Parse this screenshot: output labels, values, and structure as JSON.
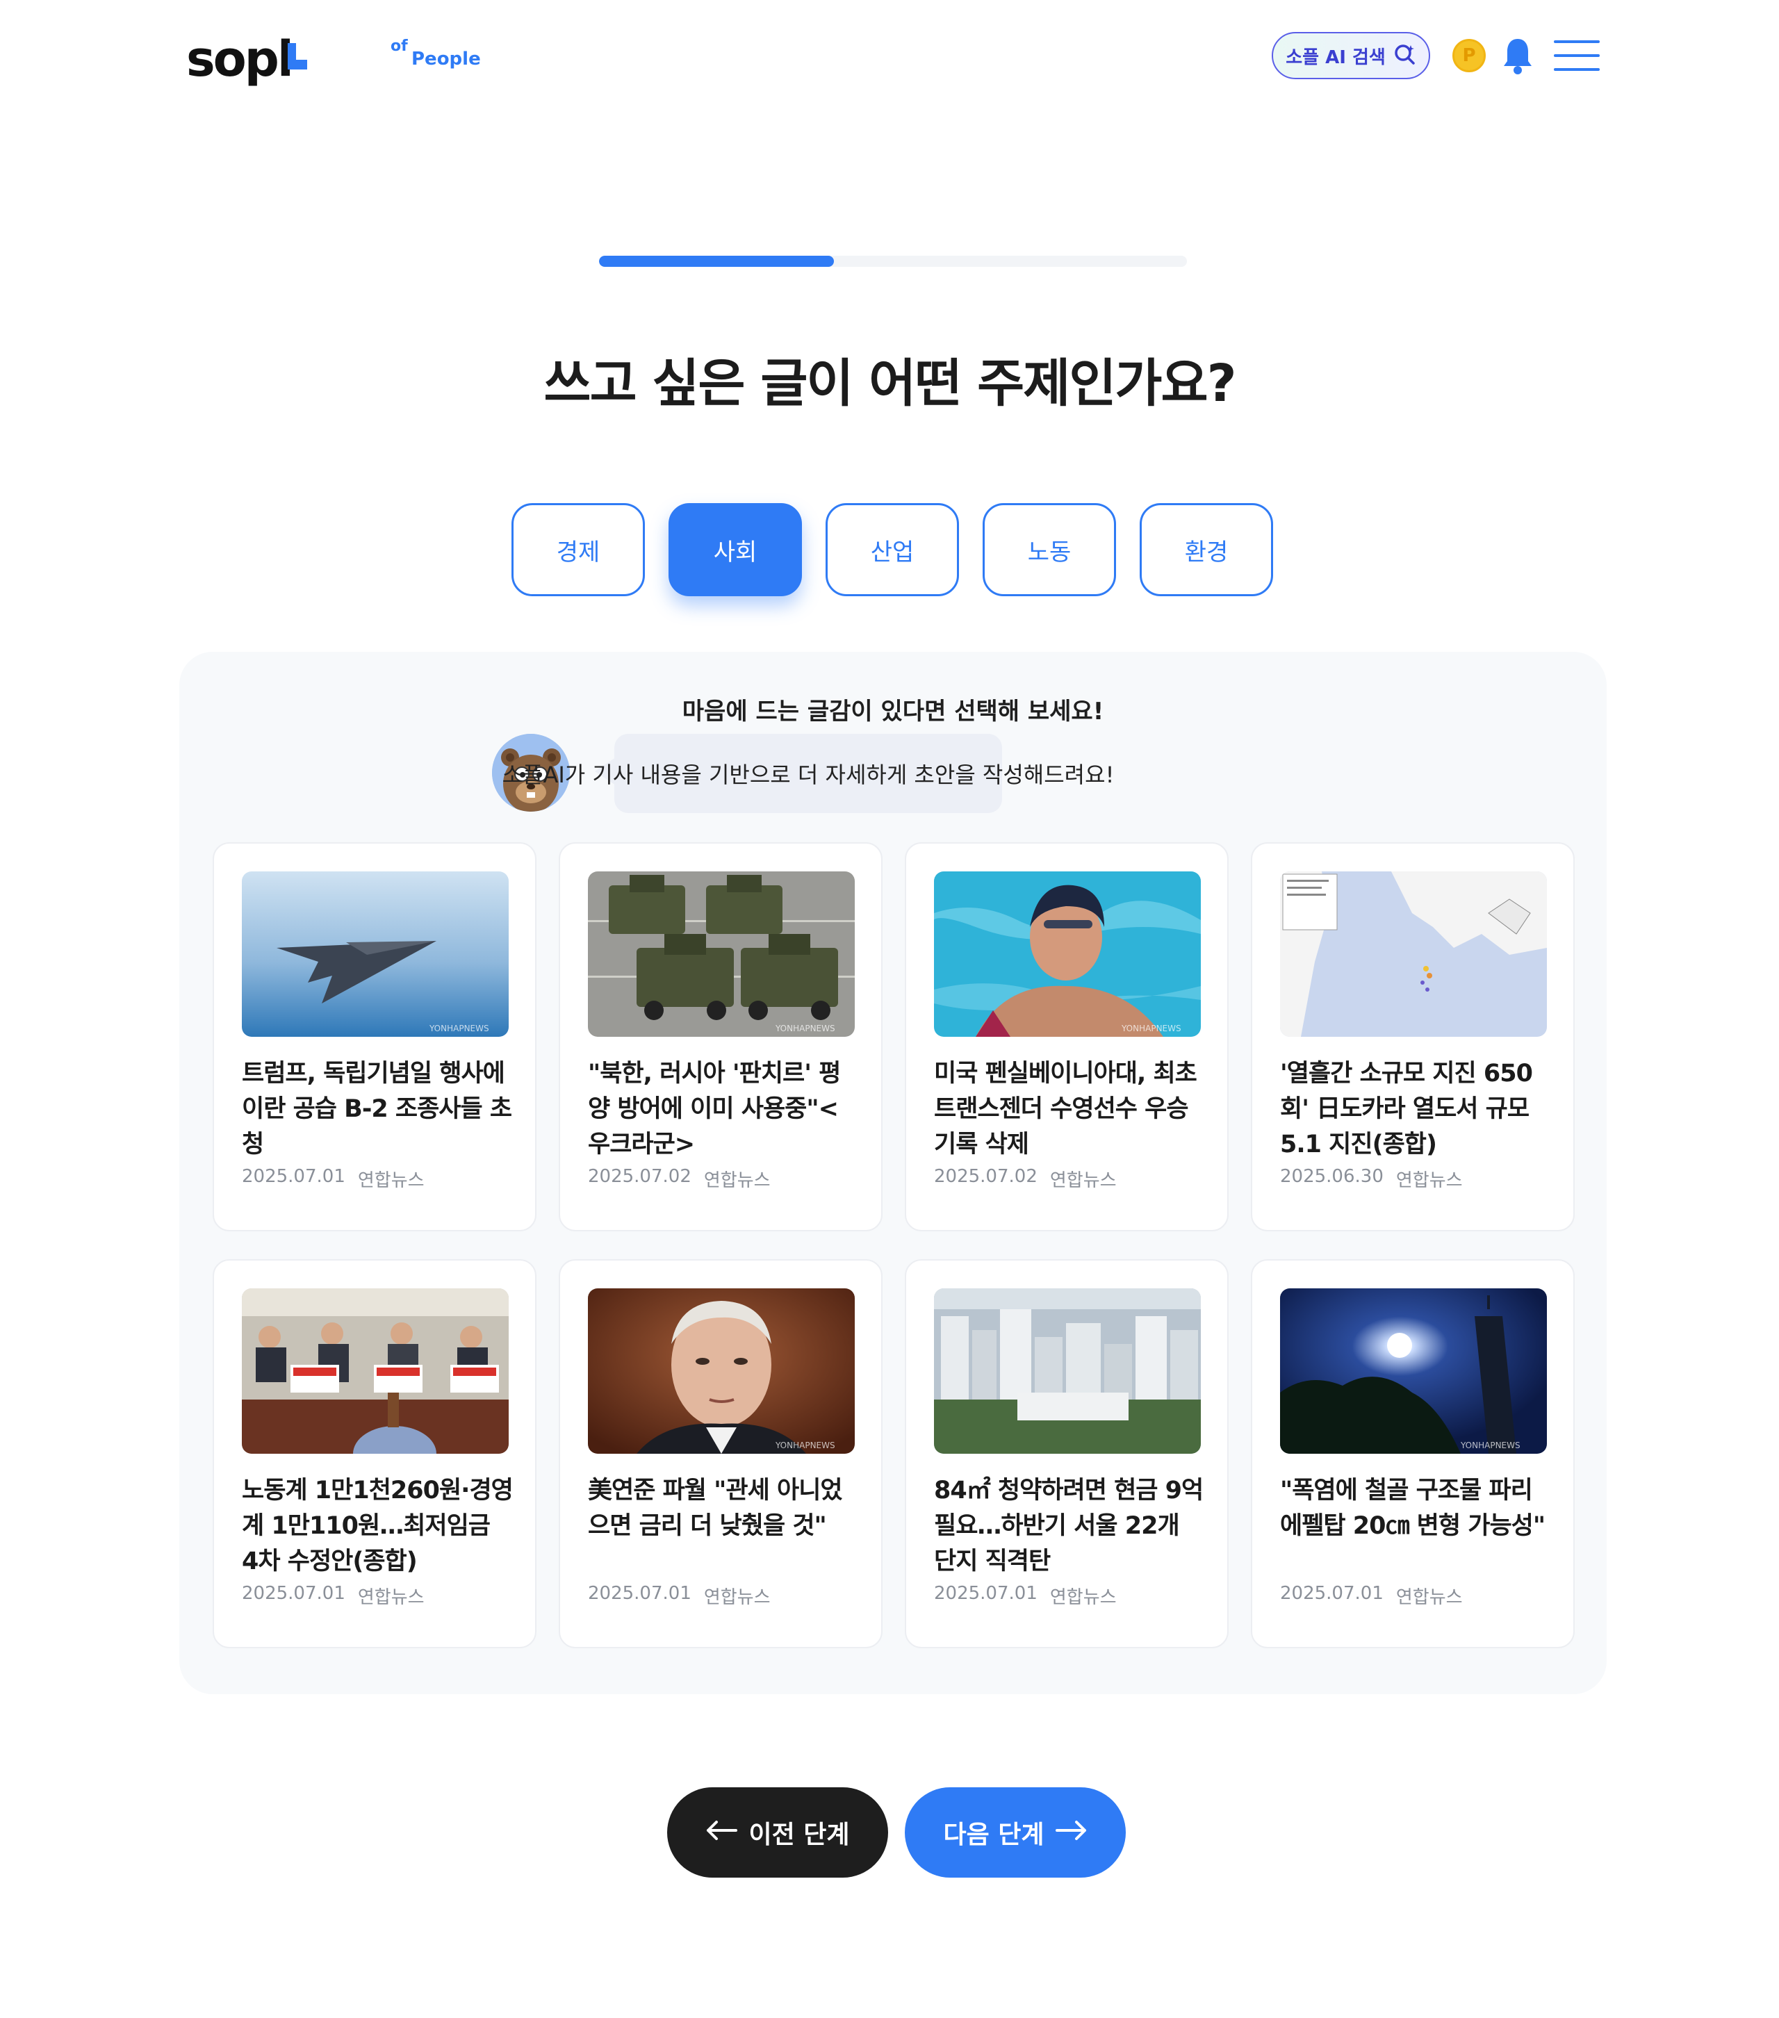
{
  "header": {
    "logo_text": "sopl",
    "tagline_of": "of",
    "tagline_people": "People",
    "ai_search_label": "소플 AI 검색",
    "coin_label": "P"
  },
  "progress": {
    "fraction": 0.4
  },
  "question": "쓰고 싶은 글이 어떤 주제인가요?",
  "topics": [
    {
      "label": "경제",
      "active": false
    },
    {
      "label": "사회",
      "active": true
    },
    {
      "label": "산업",
      "active": false
    },
    {
      "label": "노동",
      "active": false
    },
    {
      "label": "환경",
      "active": false
    }
  ],
  "panel": {
    "title": "마음에 드는 글감이 있다면 선택해 보세요!",
    "bubble": "소플AI가 기사 내용을 기반으로 더 자세하게 초안을 작성해드려요!"
  },
  "articles": [
    {
      "title": "트럼프, 독립기념일 행사에 이란 공습 B-2 조종사들 초청",
      "date": "2025.07.01",
      "source": "연합뉴스",
      "image": "stealth-bomber"
    },
    {
      "title": "\"북한, 러시아 '판치르' 평양 방어에 이미 사용중\"<우크라군>",
      "date": "2025.07.02",
      "source": "연합뉴스",
      "image": "military-vehicles"
    },
    {
      "title": "미국 펜실베이니아대, 최초 트랜스젠더 수영선수 우승 기록 삭제",
      "date": "2025.07.02",
      "source": "연합뉴스",
      "image": "swimmer"
    },
    {
      "title": "'열흘간 소규모 지진 650회' 日도카라 열도서 규모 5.1 지진(종합)",
      "date": "2025.06.30",
      "source": "연합뉴스",
      "image": "earthquake-map"
    },
    {
      "title": "노동계 1만1천260원·경영계 1만110원…최저임금 4차 수정안(종합)",
      "date": "2025.07.01",
      "source": "연합뉴스",
      "image": "meeting"
    },
    {
      "title": "美연준 파월 \"관세 아니었으면 금리 더 낮췄을 것\"",
      "date": "2025.07.01",
      "source": "연합뉴스",
      "image": "portrait"
    },
    {
      "title": "84㎡ 청약하려면 현금 9억 필요…하반기 서울 22개 단지 직격탄",
      "date": "2025.07.01",
      "source": "연합뉴스",
      "image": "city-apartments"
    },
    {
      "title": "\"폭염에 철골 구조물 파리 에펠탑 20㎝ 변형 가능성\"",
      "date": "2025.07.01",
      "source": "연합뉴스",
      "image": "eiffel-sun"
    }
  ],
  "watermark": "YONHAPNEWS",
  "buttons": {
    "prev_label": "이전 단계",
    "next_label": "다음 단계"
  },
  "colors": {
    "accent": "#2f7bf5",
    "dark": "#1e1e1e"
  }
}
